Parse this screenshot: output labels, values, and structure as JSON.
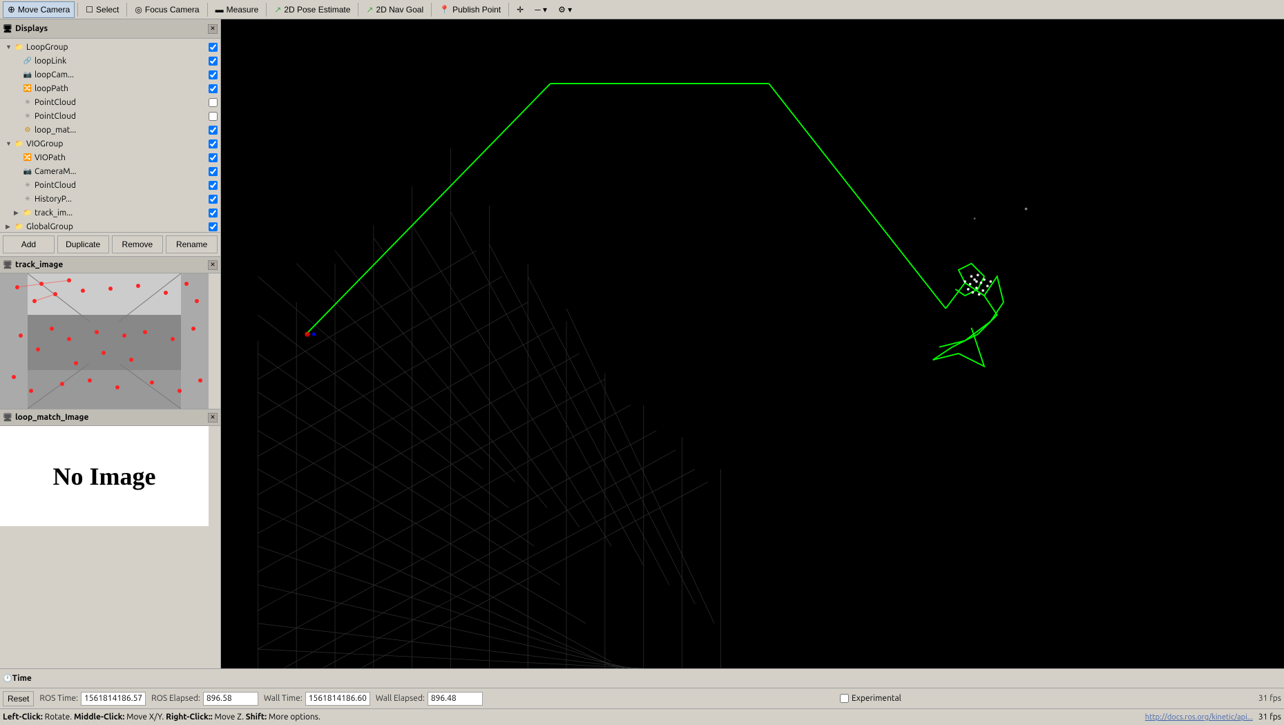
{
  "toolbar": {
    "tools": [
      {
        "id": "move-camera",
        "label": "Move Camera",
        "icon": "⊕",
        "active": true
      },
      {
        "id": "select",
        "label": "Select",
        "icon": "↖",
        "active": false
      },
      {
        "id": "focus-camera",
        "label": "Focus Camera",
        "icon": "◎",
        "active": false
      },
      {
        "id": "measure",
        "label": "Measure",
        "icon": "⊞",
        "active": false
      },
      {
        "id": "pose-estimate",
        "label": "2D Pose Estimate",
        "icon": "↗",
        "active": false
      },
      {
        "id": "nav-goal",
        "label": "2D Nav Goal",
        "icon": "↗",
        "active": false
      },
      {
        "id": "publish-point",
        "label": "Publish Point",
        "icon": "📍",
        "active": false
      }
    ]
  },
  "displays": {
    "title": "Displays",
    "items": [
      {
        "id": "loop-group",
        "label": "LoopGroup",
        "depth": 1,
        "icon": "folder",
        "arrow": "▼",
        "checked": true,
        "color": "#6699cc"
      },
      {
        "id": "loop-link",
        "label": "loopLink",
        "depth": 2,
        "icon": "link",
        "arrow": " ",
        "checked": true,
        "color": "#888"
      },
      {
        "id": "loop-cam",
        "label": "loopCam...",
        "depth": 2,
        "icon": "cam",
        "arrow": " ",
        "checked": true,
        "color": "#aa6600"
      },
      {
        "id": "loop-path",
        "label": "loopPath",
        "depth": 2,
        "icon": "path",
        "arrow": " ",
        "checked": true,
        "color": "#44aa44"
      },
      {
        "id": "point-cloud-1",
        "label": "PointCloud",
        "depth": 2,
        "icon": "cloud",
        "arrow": " ",
        "checked": false,
        "color": "#888"
      },
      {
        "id": "point-cloud-2",
        "label": "PointCloud",
        "depth": 2,
        "icon": "cloud",
        "arrow": " ",
        "checked": false,
        "color": "#888"
      },
      {
        "id": "loop-match",
        "label": "loop_mat...",
        "depth": 2,
        "icon": "match",
        "arrow": " ",
        "checked": true,
        "color": "#cc8800"
      },
      {
        "id": "vio-group",
        "label": "VIOGroup",
        "depth": 1,
        "icon": "folder",
        "arrow": "▼",
        "checked": true,
        "color": "#6699cc"
      },
      {
        "id": "vio-path",
        "label": "VIOPath",
        "depth": 2,
        "icon": "path",
        "arrow": " ",
        "checked": true,
        "color": "#44aa44"
      },
      {
        "id": "camera-m",
        "label": "CameraM...",
        "depth": 2,
        "icon": "cam",
        "arrow": " ",
        "checked": true,
        "color": "#aa6600"
      },
      {
        "id": "point-cloud-3",
        "label": "PointCloud",
        "depth": 2,
        "icon": "cloud",
        "arrow": " ",
        "checked": true,
        "color": "#888"
      },
      {
        "id": "history-p",
        "label": "HistoryP...",
        "depth": 2,
        "icon": "hist",
        "arrow": " ",
        "checked": true,
        "color": "#888"
      },
      {
        "id": "track-im",
        "label": "track_im...",
        "depth": 2,
        "icon": "track",
        "arrow": "▶",
        "checked": true,
        "color": "#888"
      },
      {
        "id": "global-group",
        "label": "GlobalGroup",
        "depth": 1,
        "icon": "folder",
        "arrow": "▶",
        "checked": true,
        "color": "#6699cc"
      }
    ],
    "buttons": [
      "Add",
      "Duplicate",
      "Remove",
      "Rename"
    ]
  },
  "track_image": {
    "title": "track_image"
  },
  "loop_match": {
    "title": "loop_match_Image",
    "no_image_text": "No Image"
  },
  "time_panel": {
    "title": "Time",
    "ros_time_label": "ROS Time:",
    "ros_time_value": "1561814186.57",
    "ros_elapsed_label": "ROS Elapsed:",
    "ros_elapsed_value": "896.58",
    "wall_time_label": "Wall Time:",
    "wall_time_value": "1561814186.60",
    "wall_elapsed_label": "Wall Elapsed:",
    "wall_elapsed_value": "896.48",
    "experimental_label": "Experimental",
    "reset_label": "Reset"
  },
  "status_bar": {
    "hint": "Left-Click: Rotate. Middle-Click: Move X/Y. Right-Click:: Move Z. Shift: More options.",
    "fps": "31 fps",
    "url": "http://docs.ros.org/kinetic/api..."
  }
}
